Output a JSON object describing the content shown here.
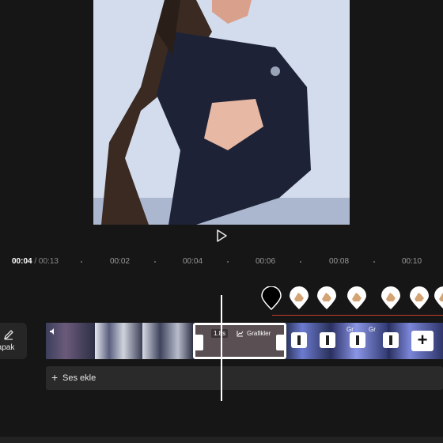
{
  "timeline": {
    "current_time": "00:04",
    "separator": " / ",
    "total_time": "00:13",
    "ticks": [
      "00:02",
      "00:04",
      "00:06",
      "00:08",
      "00:10"
    ]
  },
  "clips": {
    "selected_speed": "1.8s",
    "selected_effect": "Grafikler",
    "right_effect_a": "Gr",
    "right_effect_b": "Gr"
  },
  "toolbar": {
    "cover_label": "Kapak"
  },
  "audio": {
    "add_label": "Ses ekle"
  },
  "colors": {
    "background": "#161616",
    "playhead": "#ffffff",
    "marker_line": "#c0392b",
    "clip_border": "#ffffff"
  },
  "icons": [
    "play-icon",
    "pencil-icon",
    "plus-icon",
    "graph-icon",
    "speaker-icon",
    "hand-marker-icon"
  ]
}
